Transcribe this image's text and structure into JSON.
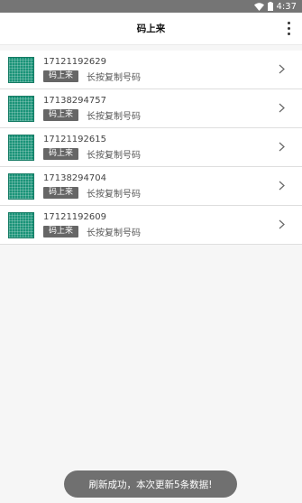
{
  "status_bar": {
    "time": "4:37",
    "wifi_icon": "wifi-icon",
    "battery_icon": "battery-icon"
  },
  "app_bar": {
    "title": "码上来",
    "menu_icon": "more-vert-icon"
  },
  "items": [
    {
      "number": "17121192629",
      "badge": "码上来",
      "hint": "长按复制号码"
    },
    {
      "number": "17138294757",
      "badge": "码上来",
      "hint": "长按复制号码"
    },
    {
      "number": "17121192615",
      "badge": "码上来",
      "hint": "长按复制号码"
    },
    {
      "number": "17138294704",
      "badge": "码上来",
      "hint": "长按复制号码"
    },
    {
      "number": "17121192609",
      "badge": "码上来",
      "hint": "长按复制号码"
    }
  ],
  "toast": {
    "message": "刷新成功，本次更新5条数据!"
  },
  "colors": {
    "thumbnail": "#1a9378",
    "badge_bg": "#666666",
    "status_bar_bg": "#757575",
    "toast_bg": "#707070"
  }
}
